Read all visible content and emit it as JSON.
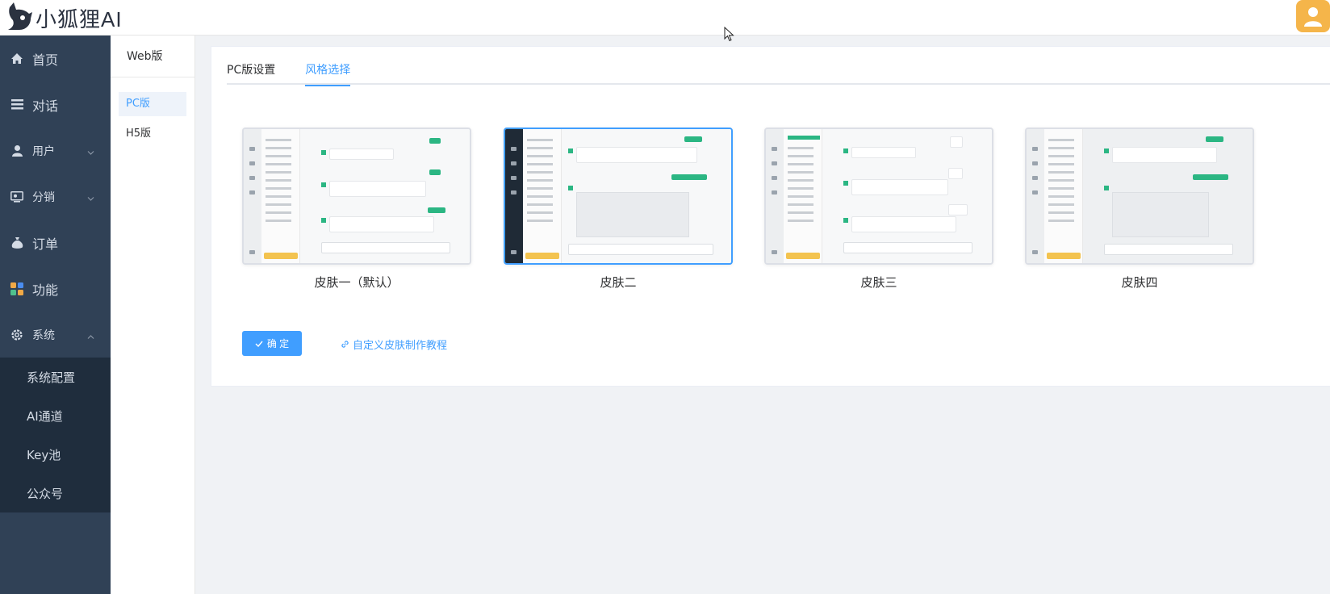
{
  "app": {
    "logo_text": "小狐狸AI"
  },
  "sidebar": {
    "items": [
      {
        "label": "首页",
        "icon": "home-icon"
      },
      {
        "label": "对话",
        "icon": "list-icon"
      },
      {
        "label": "用户",
        "icon": "user-icon"
      },
      {
        "label": "分销",
        "icon": "distribution-icon"
      },
      {
        "label": "订单",
        "icon": "money-bag-icon"
      },
      {
        "label": "功能",
        "icon": "apps-icon"
      },
      {
        "label": "系统",
        "icon": "gear-icon"
      }
    ],
    "system_submenu": [
      "系统配置",
      "AI通道",
      "Key池",
      "公众号"
    ]
  },
  "subnav": {
    "title": "Web版",
    "items": [
      "PC版",
      "H5版"
    ],
    "active": "PC版"
  },
  "tabs": {
    "items": [
      "PC版设置",
      "风格选择"
    ],
    "active": "风格选择"
  },
  "skins": [
    {
      "name": "皮肤一（默认）",
      "selected": false
    },
    {
      "name": "皮肤二",
      "selected": true
    },
    {
      "name": "皮肤三",
      "selected": false
    },
    {
      "name": "皮肤四",
      "selected": false
    }
  ],
  "actions": {
    "confirm_label": "确 定",
    "tutorial_link": "自定义皮肤制作教程"
  },
  "colors": {
    "sidebar": "#304156",
    "submenu": "#1f2d3d",
    "primary": "#409eff",
    "avatar": "#f5b54a"
  }
}
